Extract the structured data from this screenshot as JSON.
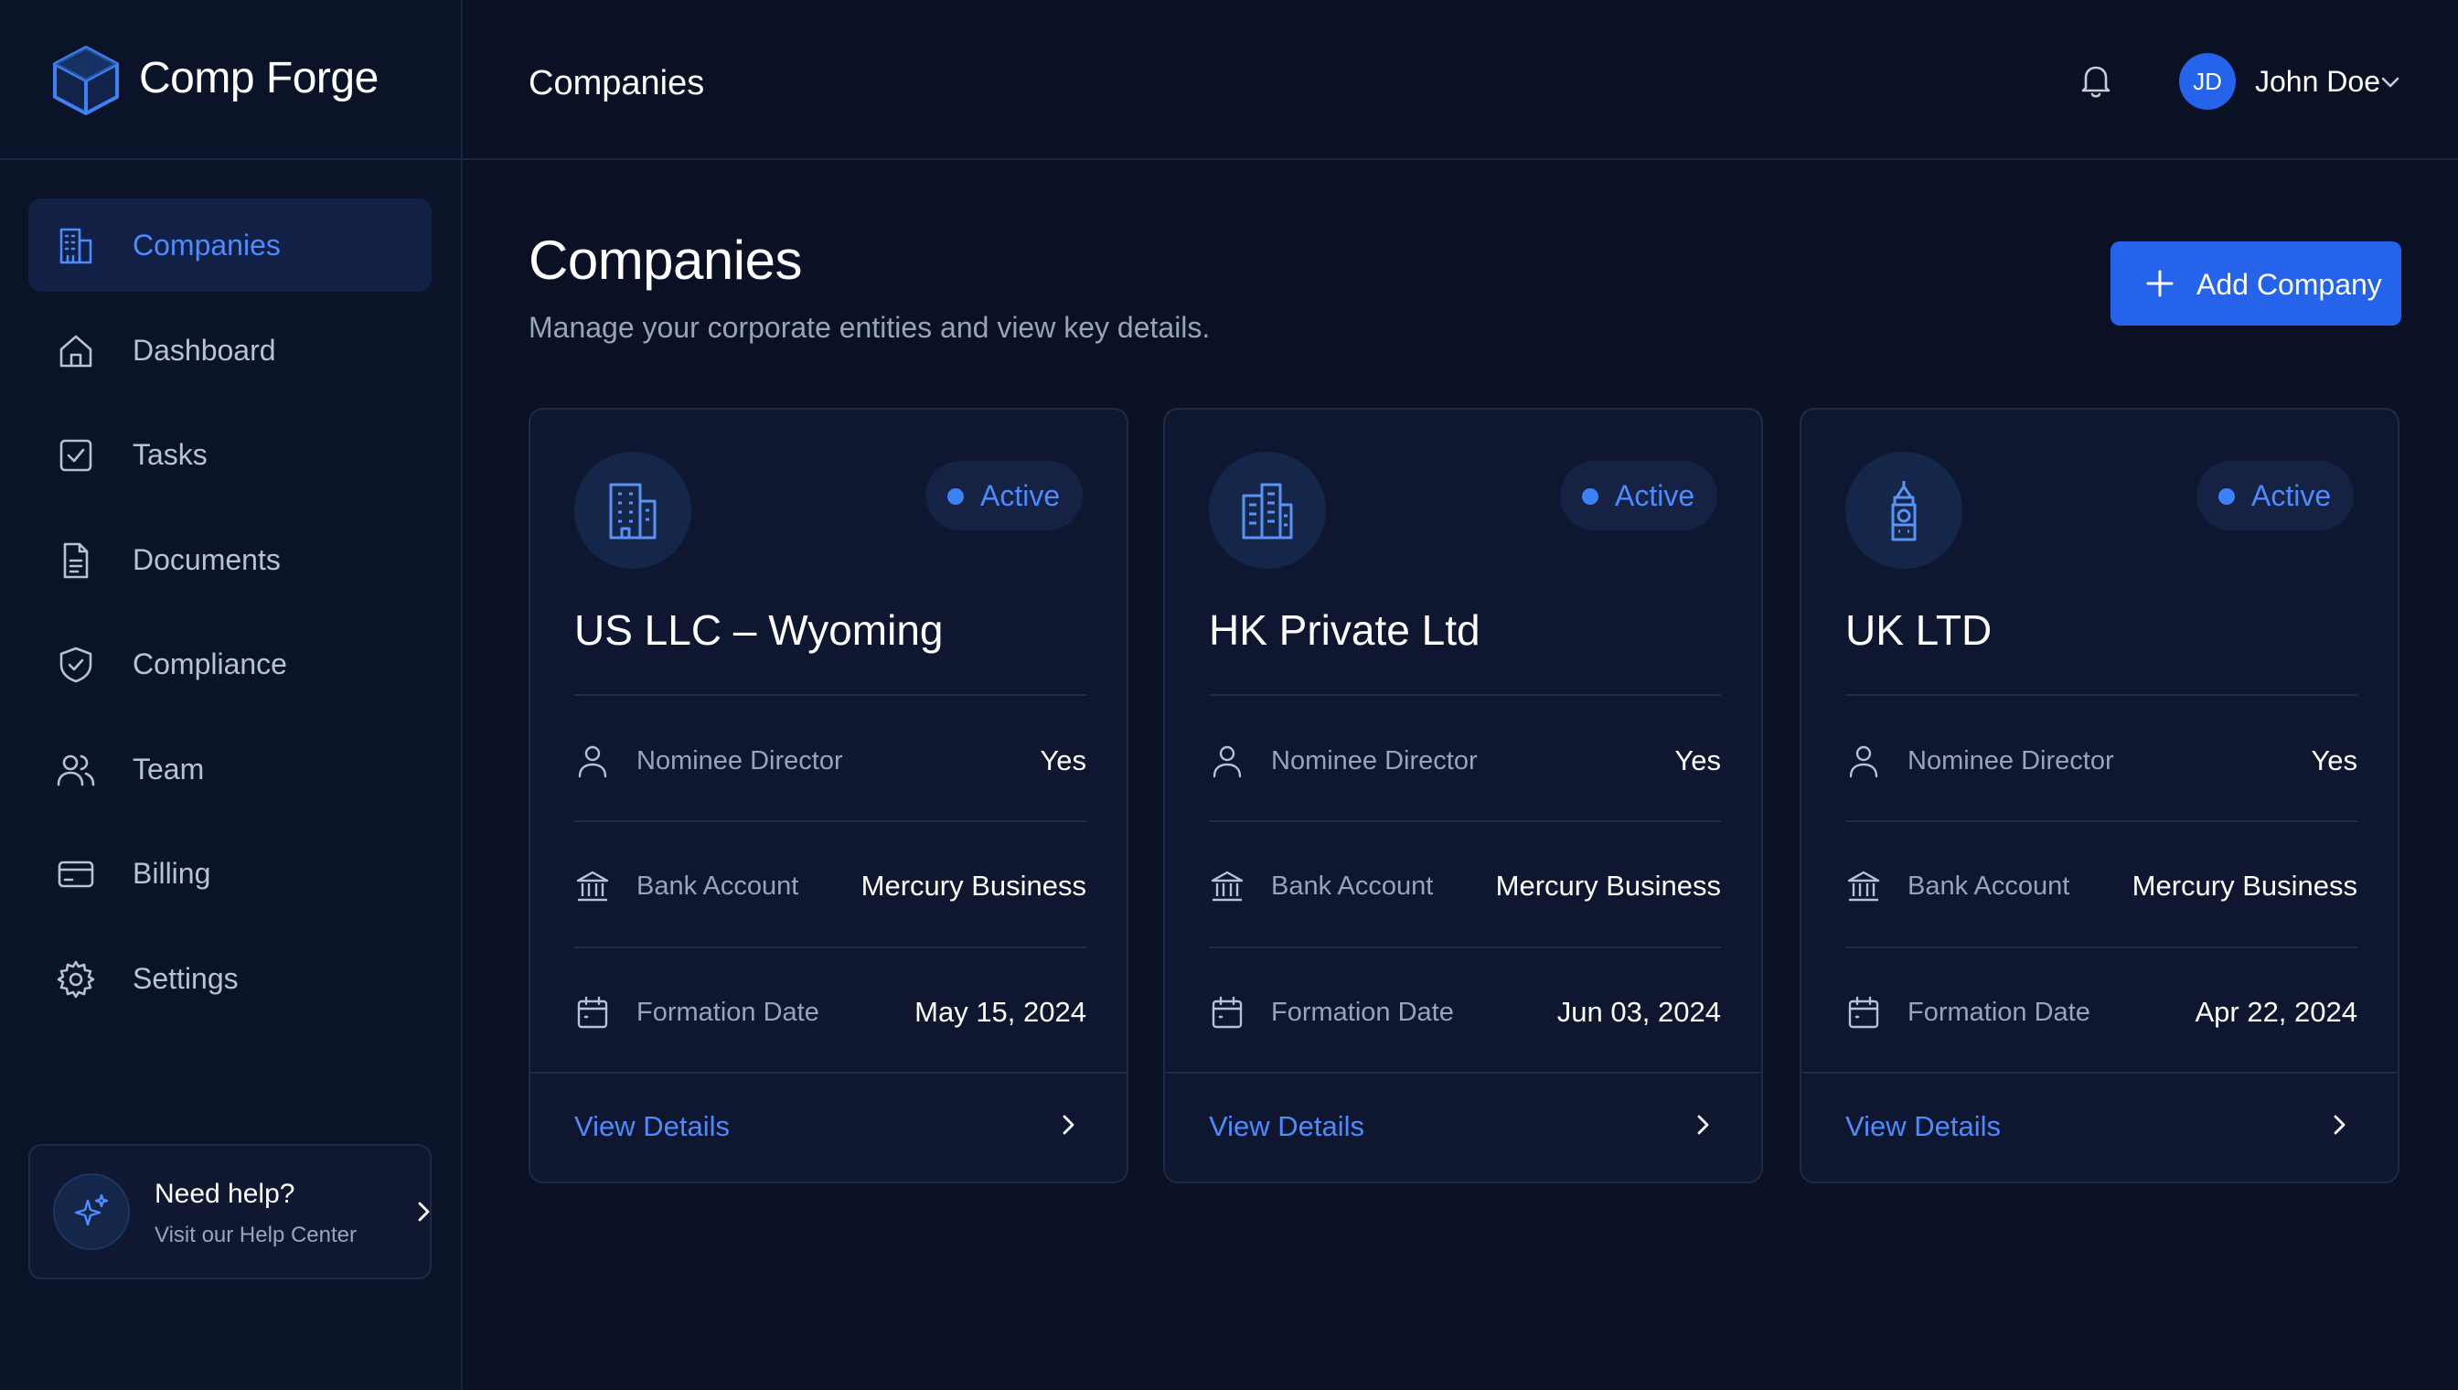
{
  "brand": {
    "name": "Comp Forge"
  },
  "header": {
    "title": "Companies",
    "user": {
      "initials": "JD",
      "name": "John Doe"
    }
  },
  "sidebar": {
    "items": [
      {
        "label": "Companies",
        "icon": "building-icon",
        "active": true
      },
      {
        "label": "Dashboard",
        "icon": "home-icon",
        "active": false
      },
      {
        "label": "Tasks",
        "icon": "check-square-icon",
        "active": false
      },
      {
        "label": "Documents",
        "icon": "document-icon",
        "active": false
      },
      {
        "label": "Compliance",
        "icon": "shield-check-icon",
        "active": false
      },
      {
        "label": "Team",
        "icon": "users-icon",
        "active": false
      },
      {
        "label": "Billing",
        "icon": "credit-card-icon",
        "active": false
      },
      {
        "label": "Settings",
        "icon": "gear-icon",
        "active": false
      }
    ],
    "help": {
      "title": "Need help?",
      "subtitle": "Visit our Help Center"
    }
  },
  "main": {
    "title": "Companies",
    "subtitle": "Manage your corporate entities and view key details.",
    "add_button": "Add Company",
    "cards": [
      {
        "name": "US LLC – Wyoming",
        "icon": "office-building-icon",
        "status": "Active",
        "rows": [
          {
            "label": "Nominee Director",
            "value": "Yes",
            "icon": "user-icon"
          },
          {
            "label": "Bank Account",
            "value": "Mercury Business",
            "icon": "bank-icon"
          },
          {
            "label": "Formation Date",
            "value": "May 15, 2024",
            "icon": "calendar-icon"
          }
        ],
        "link": "View Details"
      },
      {
        "name": "HK Private Ltd",
        "icon": "skyscraper-icon",
        "status": "Active",
        "rows": [
          {
            "label": "Nominee Director",
            "value": "Yes",
            "icon": "user-icon"
          },
          {
            "label": "Bank Account",
            "value": "Mercury Business",
            "icon": "bank-icon"
          },
          {
            "label": "Formation Date",
            "value": "Jun 03, 2024",
            "icon": "calendar-icon"
          }
        ],
        "link": "View Details"
      },
      {
        "name": "UK LTD",
        "icon": "big-ben-icon",
        "status": "Active",
        "rows": [
          {
            "label": "Nominee Director",
            "value": "Yes",
            "icon": "user-icon"
          },
          {
            "label": "Bank Account",
            "value": "Mercury Business",
            "icon": "bank-icon"
          },
          {
            "label": "Formation Date",
            "value": "Apr 22, 2024",
            "icon": "calendar-icon"
          }
        ],
        "link": "View Details"
      }
    ]
  },
  "colors": {
    "background": "#0a1125",
    "sidebar": "#0b1328",
    "card": "#0e1630",
    "accent": "#2563eb",
    "accent_text": "#4d8bff",
    "muted_text": "#9aa4b8"
  }
}
